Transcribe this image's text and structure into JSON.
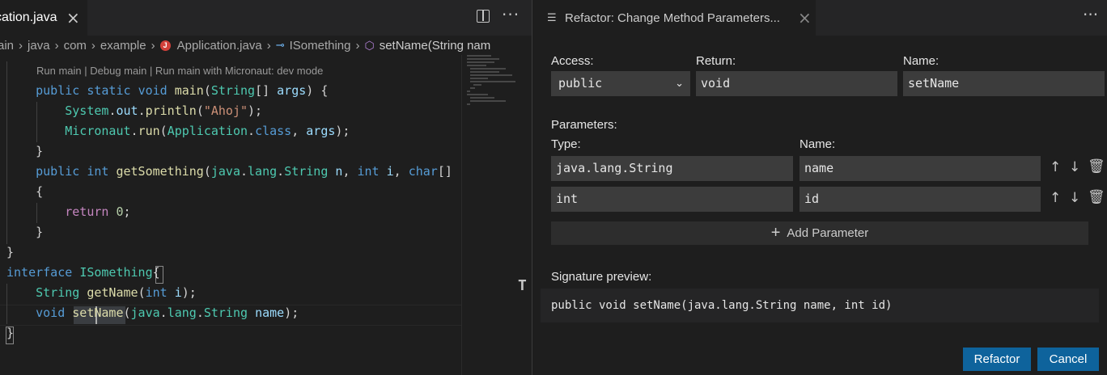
{
  "editor": {
    "tab_label": "cation.java",
    "tab_close": "×",
    "more": "···",
    "breadcrumb": [
      "ain",
      "java",
      "com",
      "example",
      "Application.java",
      "ISomething",
      "setName(String nam"
    ],
    "codelens": "Run main | Debug main | Run main with Micronaut: dev mode",
    "drag_glyph": "T"
  },
  "panel": {
    "tab_label": "Refactor: Change Method Parameters...",
    "tab_close": "×",
    "more": "···",
    "access_label": "Access:",
    "access_value": "public",
    "return_label": "Return:",
    "return_value": "void",
    "name_label": "Name:",
    "name_value": "setName",
    "parameters_label": "Parameters:",
    "type_col_label": "Type:",
    "name_col_label": "Name:",
    "parameters": [
      {
        "type": "java.lang.String",
        "name": "name"
      },
      {
        "type": "int",
        "name": "id"
      }
    ],
    "add_parameter": "Add Parameter",
    "signature_label": "Signature preview:",
    "signature": "public void setName(java.lang.String name, int id)",
    "refactor_button": "Refactor",
    "cancel_button": "Cancel"
  },
  "colors": {
    "accent_button": "#0e639c",
    "editor_bg": "#1e1e1e",
    "field_bg": "#3c3c3c"
  }
}
